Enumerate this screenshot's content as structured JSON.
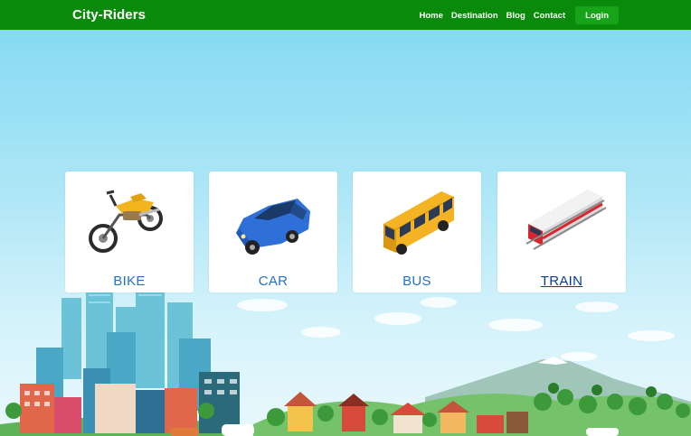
{
  "navbar": {
    "brand": "City-Riders",
    "links": [
      "Home",
      "Destination",
      "Blog",
      "Contact"
    ],
    "login_label": "Login"
  },
  "cards": [
    {
      "label": "BIKE",
      "icon": "motorbike-icon"
    },
    {
      "label": "CAR",
      "icon": "car-icon"
    },
    {
      "label": "BUS",
      "icon": "bus-icon"
    },
    {
      "label": "TRAIN",
      "icon": "train-icon",
      "active": true
    }
  ],
  "colors": {
    "navbar": "#0a8a0a",
    "login_button": "#18a418",
    "card_label": "#1f73c9",
    "card_label_active": "#0d3d8c",
    "sky": "#7fd8f2"
  }
}
